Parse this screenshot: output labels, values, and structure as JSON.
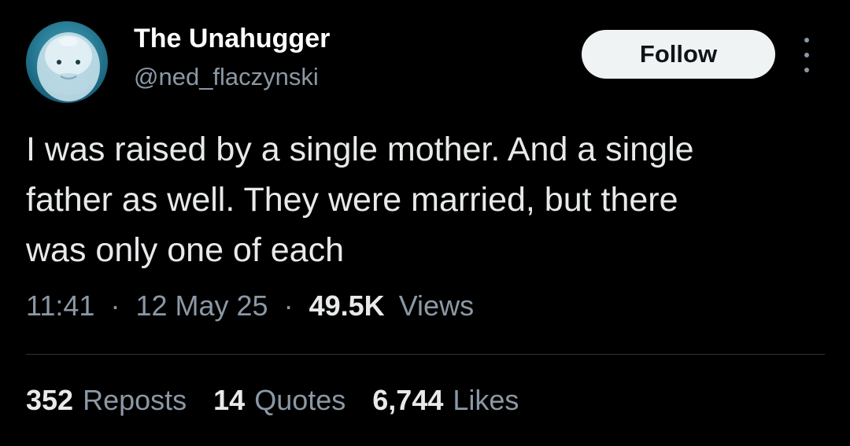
{
  "author": {
    "display_name": "The Unahugger",
    "handle": "@ned_flaczynski",
    "avatar_icon": "beluga-whale-avatar"
  },
  "actions": {
    "follow_label": "Follow",
    "more_icon": "more-options-icon"
  },
  "tweet": {
    "lines": [
      "I was raised by a single mother. And a single",
      "father as well. They were married, but there",
      "was only one of each"
    ]
  },
  "meta": {
    "time": "11:41",
    "separator": "·",
    "date": "12 May 25",
    "views_count": "49.5K",
    "views_label": "Views"
  },
  "stats": {
    "reposts_count": "352",
    "reposts_label": "Reposts",
    "quotes_count": "14",
    "quotes_label": "Quotes",
    "likes_count": "6,744",
    "likes_label": "Likes"
  },
  "colors": {
    "background": "#000000",
    "primary_text": "#e7e9ea",
    "secondary_text": "#8b98a5",
    "follow_button_bg": "#eff3f4",
    "divider": "#2f3336"
  }
}
